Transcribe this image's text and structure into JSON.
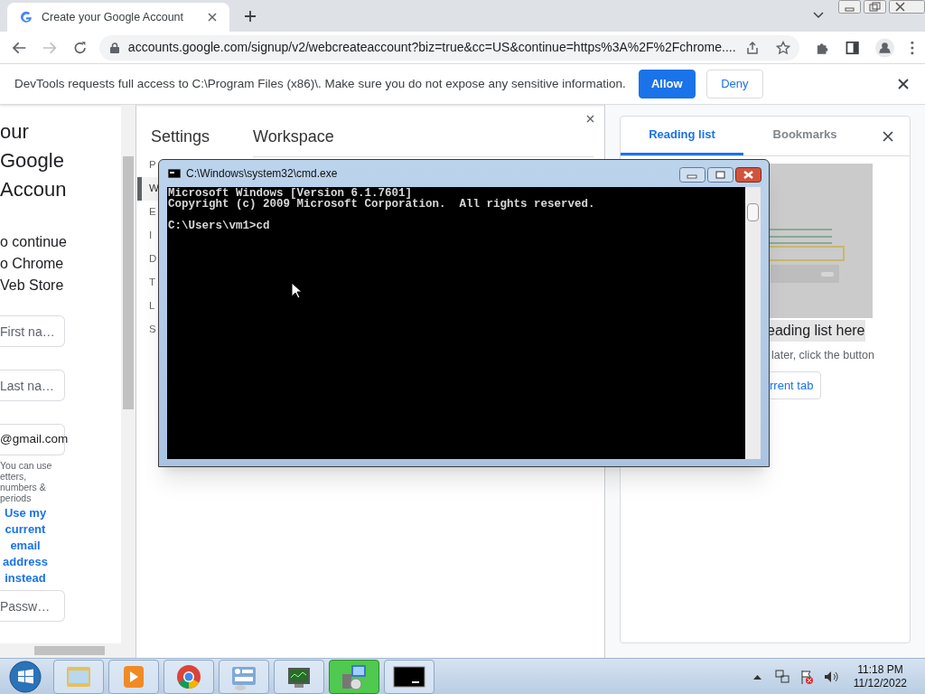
{
  "browser": {
    "tab_title": "Create your Google Account",
    "address": "accounts.google.com/signup/v2/webcreateaccount?biz=true&cc=US&continue=https%3A%2F%2Fchrome...."
  },
  "infobar": {
    "message": "DevTools requests full access to C:\\Program Files (x86)\\. Make sure you do not expose any sensitive information.",
    "buttons": [
      {
        "label": "Allow",
        "kind": "primary"
      },
      {
        "label": "Deny",
        "kind": "secondary"
      }
    ]
  },
  "signup_page": {
    "heading_lines": [
      "our",
      "Google",
      "Accoun"
    ],
    "subtitle_lines": [
      "o continue",
      "o Chrome",
      "Veb Store"
    ],
    "name_fields": [
      {
        "placeholder": "First na…"
      },
      {
        "placeholder": "Last na…"
      }
    ],
    "email_suffix": "@gmail.com",
    "helper_lines": [
      "You can use",
      "etters,",
      "numbers &",
      "periods"
    ],
    "alt_email_link": "Use my current email address instead",
    "password_field": {
      "placeholder": "Passw…"
    }
  },
  "devtools_settings": {
    "title": "Settings",
    "section_title": "Workspace",
    "nav": [
      {
        "label": "P",
        "selected": false
      },
      {
        "label": "W",
        "selected": true
      },
      {
        "label": "E",
        "selected": false
      },
      {
        "label": "I",
        "selected": false
      },
      {
        "label": "D",
        "selected": false
      },
      {
        "label": "T",
        "selected": false
      },
      {
        "label": "L",
        "selected": false
      },
      {
        "label": "S",
        "selected": false
      }
    ]
  },
  "side_panel": {
    "tabs": [
      {
        "label": "Reading list",
        "selected": true
      },
      {
        "label": "Bookmarks",
        "selected": false
      }
    ],
    "empty_title": "eading list here",
    "empty_text": "later, click the button",
    "button": "rrent tab"
  },
  "cmd_window": {
    "title": "C:\\Windows\\system32\\cmd.exe",
    "output": [
      "Microsoft Windows [Version 6.1.7601]",
      "Copyright (c) 2009 Microsoft Corporation.  All rights reserved."
    ],
    "prompt": "C:\\Users\\vm1>cd"
  },
  "taskbar": {
    "apps": [
      {
        "kind": "folder",
        "selected": false
      },
      {
        "kind": "media",
        "selected": false
      },
      {
        "kind": "chrome",
        "selected": false
      },
      {
        "kind": "panel",
        "selected": false
      },
      {
        "kind": "monitor",
        "selected": false
      },
      {
        "kind": "installer",
        "selected": true
      },
      {
        "kind": "console",
        "selected": false
      }
    ],
    "time": "11:18 PM",
    "date": "11/12/2022"
  }
}
